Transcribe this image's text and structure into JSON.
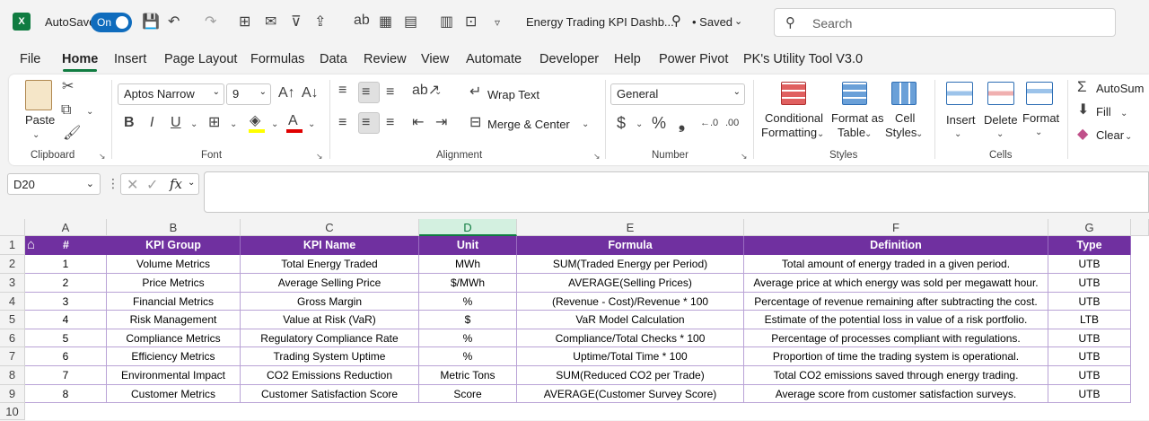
{
  "titlebar": {
    "autosave_label": "AutoSave",
    "autosave_state": "On",
    "doc_title": "Energy Trading KPI Dashb...",
    "save_status": "• Saved",
    "search_placeholder": "Search"
  },
  "menu": {
    "tabs": [
      "File",
      "Home",
      "Insert",
      "Page Layout",
      "Formulas",
      "Data",
      "Review",
      "View",
      "Automate",
      "Developer",
      "Help",
      "Power Pivot",
      "PK's Utility Tool V3.0"
    ],
    "active": "Home"
  },
  "ribbon": {
    "clipboard": {
      "label": "Clipboard",
      "paste": "Paste"
    },
    "font": {
      "label": "Font",
      "font_name": "Aptos Narrow",
      "font_size": "9"
    },
    "alignment": {
      "label": "Alignment",
      "wrap_text": "Wrap Text",
      "merge_center": "Merge & Center"
    },
    "number": {
      "label": "Number",
      "format": "General"
    },
    "styles": {
      "label": "Styles",
      "conditional_1": "Conditional",
      "conditional_2": "Formatting",
      "format_table_1": "Format as",
      "format_table_2": "Table",
      "cell_styles_1": "Cell",
      "cell_styles_2": "Styles"
    },
    "cells": {
      "label": "Cells",
      "insert": "Insert",
      "delete": "Delete",
      "format": "Format"
    },
    "editing": {
      "autosum": "AutoSum",
      "fill": "Fill",
      "clear": "Clear"
    }
  },
  "formula_bar": {
    "name_box": "D20",
    "formula": ""
  },
  "grid": {
    "columns": [
      "A",
      "B",
      "C",
      "D",
      "E",
      "F",
      "G"
    ],
    "selected_column": "D",
    "row_numbers": [
      "1",
      "2",
      "3",
      "4",
      "5",
      "6",
      "7",
      "8",
      "9",
      "10"
    ],
    "headers": [
      "#",
      "KPI Group",
      "KPI Name",
      "Unit",
      "Formula",
      "Definition",
      "Type"
    ],
    "rows": [
      [
        "1",
        "Volume Metrics",
        "Total Energy Traded",
        "MWh",
        "SUM(Traded Energy per Period)",
        "Total amount of energy traded in a given period.",
        "UTB"
      ],
      [
        "2",
        "Price Metrics",
        "Average Selling Price",
        "$/MWh",
        "AVERAGE(Selling Prices)",
        "Average price at which energy was sold per megawatt hour.",
        "UTB"
      ],
      [
        "3",
        "Financial Metrics",
        "Gross Margin",
        "%",
        "(Revenue - Cost)/Revenue * 100",
        "Percentage of revenue remaining after subtracting the cost.",
        "UTB"
      ],
      [
        "4",
        "Risk Management",
        "Value at Risk (VaR)",
        "$",
        "VaR Model Calculation",
        "Estimate of the potential loss in value of a risk portfolio.",
        "LTB"
      ],
      [
        "5",
        "Compliance Metrics",
        "Regulatory Compliance Rate",
        "%",
        "Compliance/Total Checks * 100",
        "Percentage of processes compliant with regulations.",
        "UTB"
      ],
      [
        "6",
        "Efficiency Metrics",
        "Trading System Uptime",
        "%",
        "Uptime/Total Time * 100",
        "Proportion of time the trading system is operational.",
        "UTB"
      ],
      [
        "7",
        "Environmental Impact",
        "CO2 Emissions Reduction",
        "Metric Tons",
        "SUM(Reduced CO2 per Trade)",
        "Total CO2 emissions saved through energy trading.",
        "UTB"
      ],
      [
        "8",
        "Customer Metrics",
        "Customer Satisfaction Score",
        "Score",
        "AVERAGE(Customer Survey Score)",
        "Average score from customer satisfaction surveys.",
        "UTB"
      ]
    ]
  },
  "colors": {
    "header_purple": "#7030a0",
    "excel_green": "#107c41",
    "toggle_blue": "#0f6cbd"
  }
}
